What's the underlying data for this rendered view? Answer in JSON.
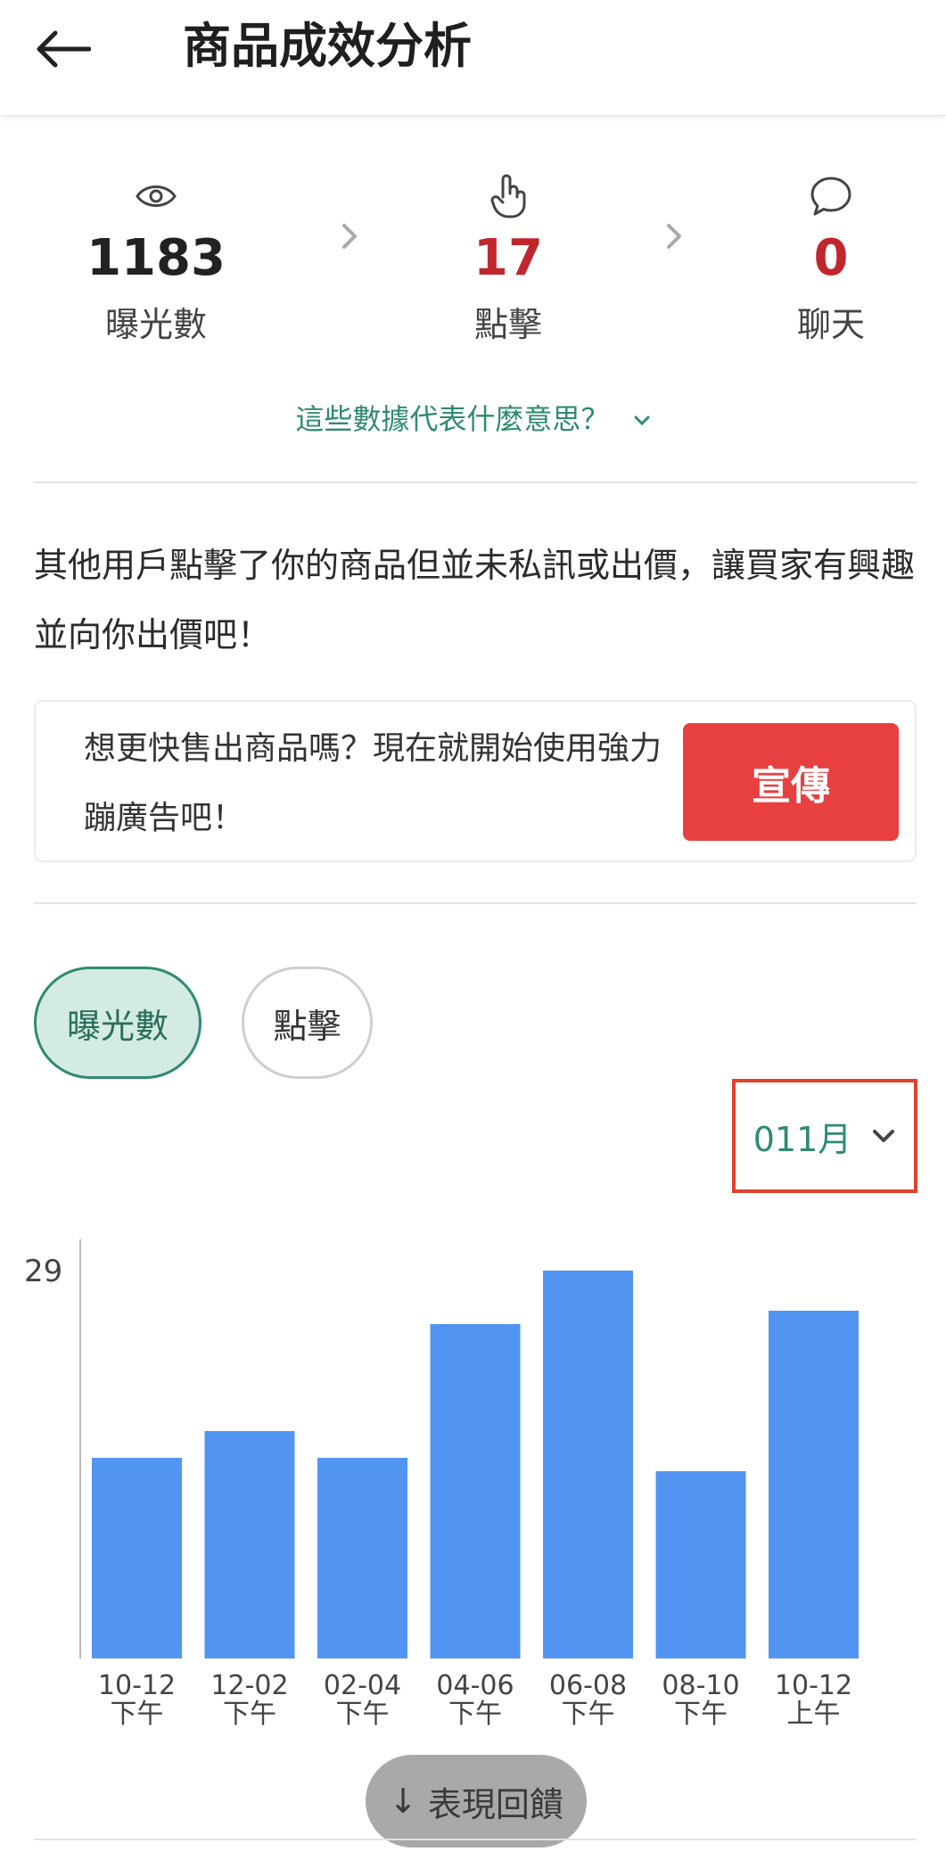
{
  "header": {
    "title": "商品成效分析",
    "back_icon": "arrow-left-icon"
  },
  "stats": [
    {
      "icon": "eye-icon",
      "value": "1183",
      "label": "曝光數",
      "color": "#222222"
    },
    {
      "icon": "hand-pointer-icon",
      "value": "17",
      "label": "點擊",
      "color": "#c0272d"
    },
    {
      "icon": "chat-bubble-icon",
      "value": "0",
      "label": "聊天",
      "color": "#c0272d"
    }
  ],
  "help_link": {
    "text": "這些數據代表什麼意思？"
  },
  "description": "其他用戶點擊了你的商品但並未私訊或出價，讓買家有興趣並向你出價吧！",
  "promo": {
    "text": "想更快售出商品嗎？現在就開始使用強力蹦廣告吧！",
    "button": "宣傳",
    "button_color": "#e84040"
  },
  "tabs": [
    {
      "label": "曝光數",
      "active": true
    },
    {
      "label": "點擊",
      "active": false
    }
  ],
  "month_select": {
    "value": "011月"
  },
  "chart_data": {
    "type": "bar",
    "categories": [
      [
        "10-12",
        "下午"
      ],
      [
        "12-02",
        "下午"
      ],
      [
        "02-04",
        "下午"
      ],
      [
        "04-06",
        "下午"
      ],
      [
        "06-08",
        "下午"
      ],
      [
        "08-10",
        "下午"
      ],
      [
        "10-12",
        "上午"
      ]
    ],
    "values": [
      15,
      17,
      15,
      25,
      29,
      14,
      26
    ],
    "ylim": [
      0,
      32
    ],
    "y_tick_labels": [
      "29"
    ],
    "bar_color": "#5294f2",
    "grid": false
  },
  "feedback_button": {
    "text": "表現回饋",
    "arrow": "↓"
  }
}
